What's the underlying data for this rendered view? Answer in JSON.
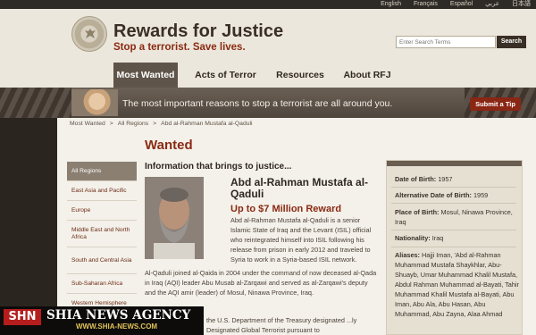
{
  "language_bar": [
    "English",
    "Français",
    "Español",
    "عربي",
    "日本語"
  ],
  "header": {
    "title": "Rewards for Justice",
    "subtitle": "Stop a terrorist. Save lives.",
    "search_placeholder": "Enter Search Terms",
    "search_button": "Search"
  },
  "nav": {
    "tabs": [
      "Most Wanted",
      "Acts of Terror",
      "Resources",
      "About RFJ"
    ],
    "active": "Most Wanted"
  },
  "banner": {
    "text": "The most important reasons to stop a terrorist are all around you.",
    "button": "Submit a Tip"
  },
  "breadcrumb": [
    "Most Wanted",
    ">",
    "All Regions",
    ">",
    "Abd al-Rahman Mustafa al-Qaduli"
  ],
  "main": {
    "heading": "Wanted",
    "info_heading": "Information that brings to justice...",
    "name": "Abd al-Rahman Mustafa al-Qaduli",
    "reward": "Up to $7 Million Reward",
    "bio_1": "Abd al-Rahman Mustafa al-Qaduli is a senior Islamic State of Iraq and the Levant (ISIL) official who reintegrated himself into ISIL following his release from prison in early 2012 and traveled to Syria to work in a Syria-based ISIL network.",
    "bio_2": "Al-Qaduli joined al-Qaida in 2004 under the command of now deceased al-Qada in Iraq (AQI) leader Abu Musab al-Zarqawi and served as al-Zarqawi's deputy and the AQI amir (leader) of Mosul, Ninawa Province, Iraq.",
    "bio_3": "the U.S. Department of the Treasury designated ...ly Designated Global Terrorist pursuant to"
  },
  "sidebar": {
    "items": [
      "All Regions",
      "East Asia and Pacific",
      "Europe",
      "Middle East and North Africa",
      "South and Central Asia",
      "Sub-Saharan Africa",
      "Western Hemisphere"
    ],
    "active": "All Regions"
  },
  "facts": {
    "dob_label": "Date of Birth:",
    "dob": "1957",
    "alt_dob_label": "Alternative Date of Birth:",
    "alt_dob": "1959",
    "pob_label": "Place of Birth:",
    "pob": "Mosul, Ninawa Province, Iraq",
    "nationality_label": "Nationality:",
    "nationality": "Iraq",
    "aliases_label": "Aliases:",
    "aliases": "Hajji Iman, 'Abd al-Rahman Muhammad Mustafa Shaykhlar, Abu-Shuayb, Umar Muhammad Khalil Mustafa, Abdul Rahman Muhammad al-Bayati, Tahir Muhammad Khalil Mustafa al-Bayati, Abu Iman, Abu Ala, Abu Hasan, Abu Muhammad, Abu Zayna, Alaa Ahmad"
  },
  "watermark": {
    "logo": "SHN",
    "title": "SHIA NEWS AGENCY",
    "url": "WWW.SHIA-NEWS.COM"
  }
}
